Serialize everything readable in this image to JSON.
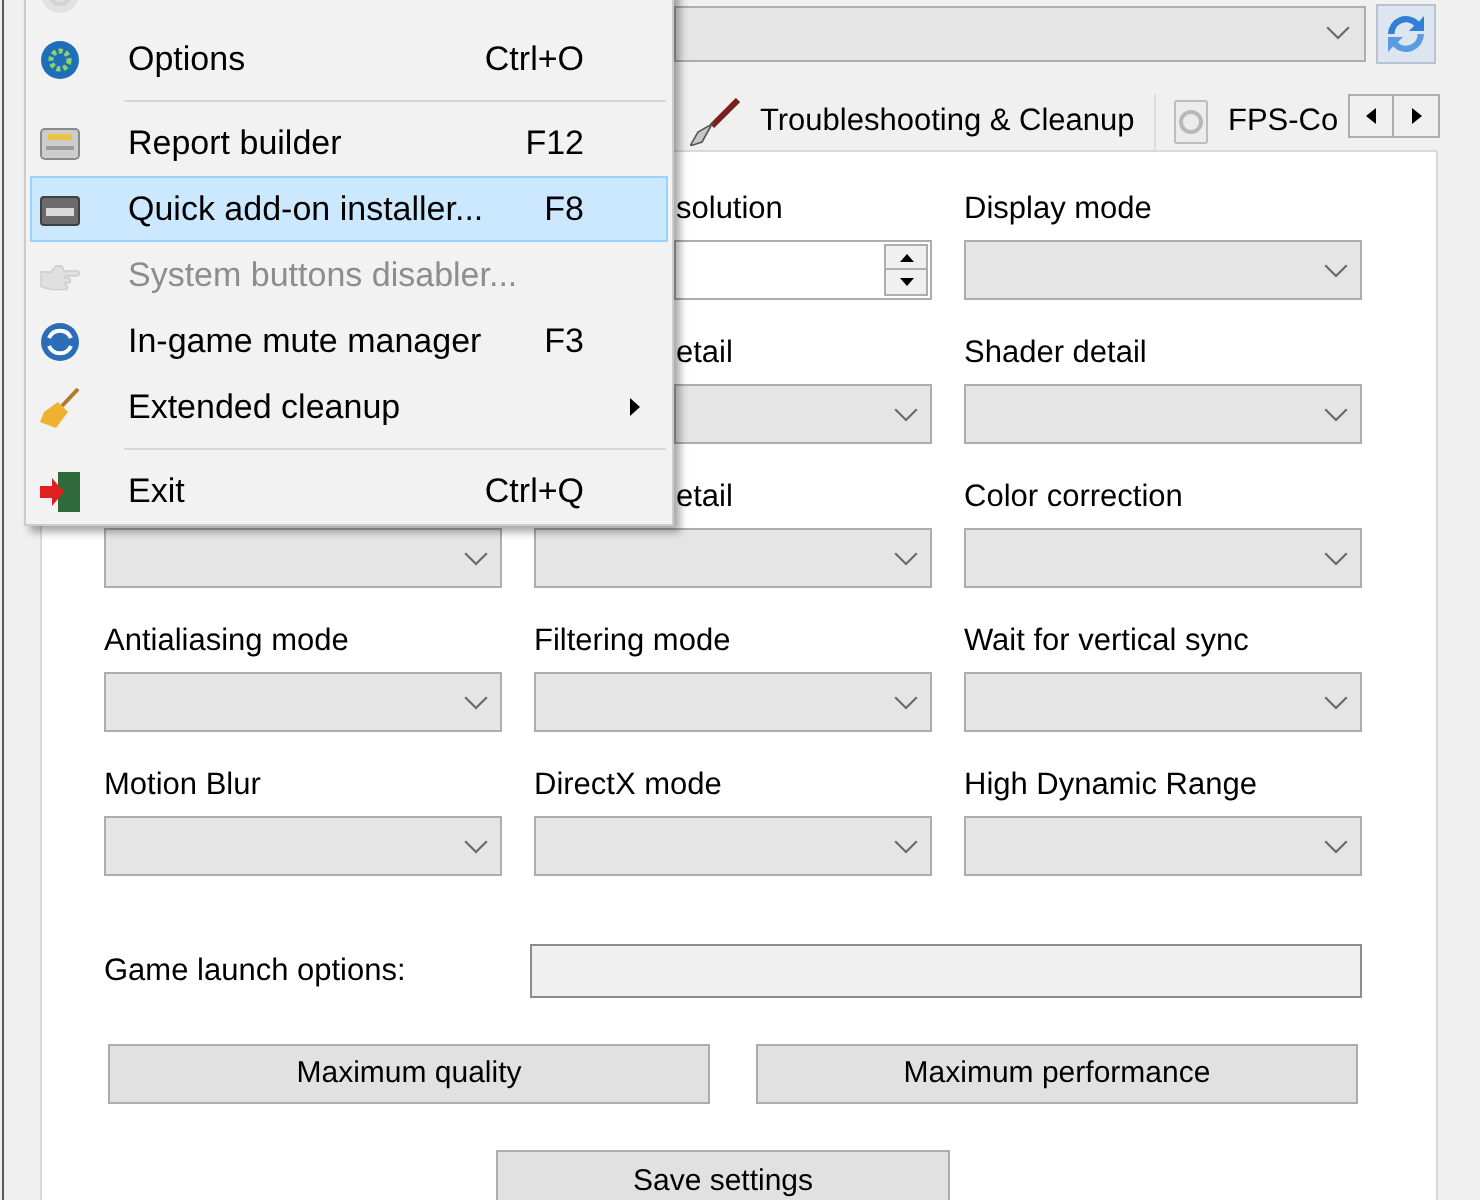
{
  "menu": {
    "items": [
      {
        "kind": "item",
        "selected": false,
        "disabled": true,
        "submenu": false
      },
      {
        "kind": "item",
        "label": "Options",
        "shortcut": "Ctrl+O",
        "selected": false,
        "disabled": false,
        "submenu": false
      },
      {
        "kind": "separator"
      },
      {
        "kind": "item",
        "label": "Report builder",
        "shortcut": "F12",
        "selected": false,
        "disabled": false,
        "submenu": false
      },
      {
        "kind": "item",
        "label": "Quick add-on installer...",
        "shortcut": "F8",
        "selected": true,
        "disabled": false,
        "submenu": false
      },
      {
        "kind": "item",
        "label": "System buttons disabler...",
        "selected": false,
        "disabled": true,
        "submenu": false
      },
      {
        "kind": "item",
        "label": "In-game mute manager",
        "shortcut": "F3",
        "selected": false,
        "disabled": false,
        "submenu": false
      },
      {
        "kind": "item",
        "label": "Extended cleanup",
        "selected": false,
        "disabled": false,
        "submenu": true
      },
      {
        "kind": "separator"
      },
      {
        "kind": "item",
        "label": "Exit",
        "shortcut": "Ctrl+Q",
        "selected": false,
        "disabled": false,
        "submenu": false
      }
    ]
  },
  "tabs": [
    {
      "label": "Troubleshooting & Cleanup",
      "selected": false
    },
    {
      "label": "FPS-Co",
      "selected": false
    }
  ],
  "settings": {
    "rows": [
      {
        "cells": [
          {
            "label": "solution",
            "kind": "spin"
          },
          {
            "label": "Display mode",
            "kind": "dropdown"
          }
        ]
      },
      {
        "cells": [
          {
            "label": "etail",
            "kind": "dropdown"
          },
          {
            "label": "Shader detail",
            "kind": "dropdown"
          }
        ]
      },
      {
        "cells": [
          {
            "kind": "dropdown"
          },
          {
            "label": "etail",
            "kind": "dropdown"
          },
          {
            "label": "Color correction",
            "kind": "dropdown"
          }
        ]
      },
      {
        "cells": [
          {
            "label": "Antialiasing mode",
            "kind": "dropdown"
          },
          {
            "label": "Filtering mode",
            "kind": "dropdown"
          },
          {
            "label": "Wait for vertical sync",
            "kind": "dropdown"
          }
        ]
      },
      {
        "cells": [
          {
            "label": "Motion Blur",
            "kind": "dropdown"
          },
          {
            "label": "DirectX mode",
            "kind": "dropdown"
          },
          {
            "label": "High Dynamic Range",
            "kind": "dropdown"
          }
        ]
      }
    ]
  },
  "launch_options": {
    "label": "Game launch options:"
  },
  "presets": [
    "Maximum quality",
    "Maximum performance"
  ],
  "save_button": "Save settings"
}
